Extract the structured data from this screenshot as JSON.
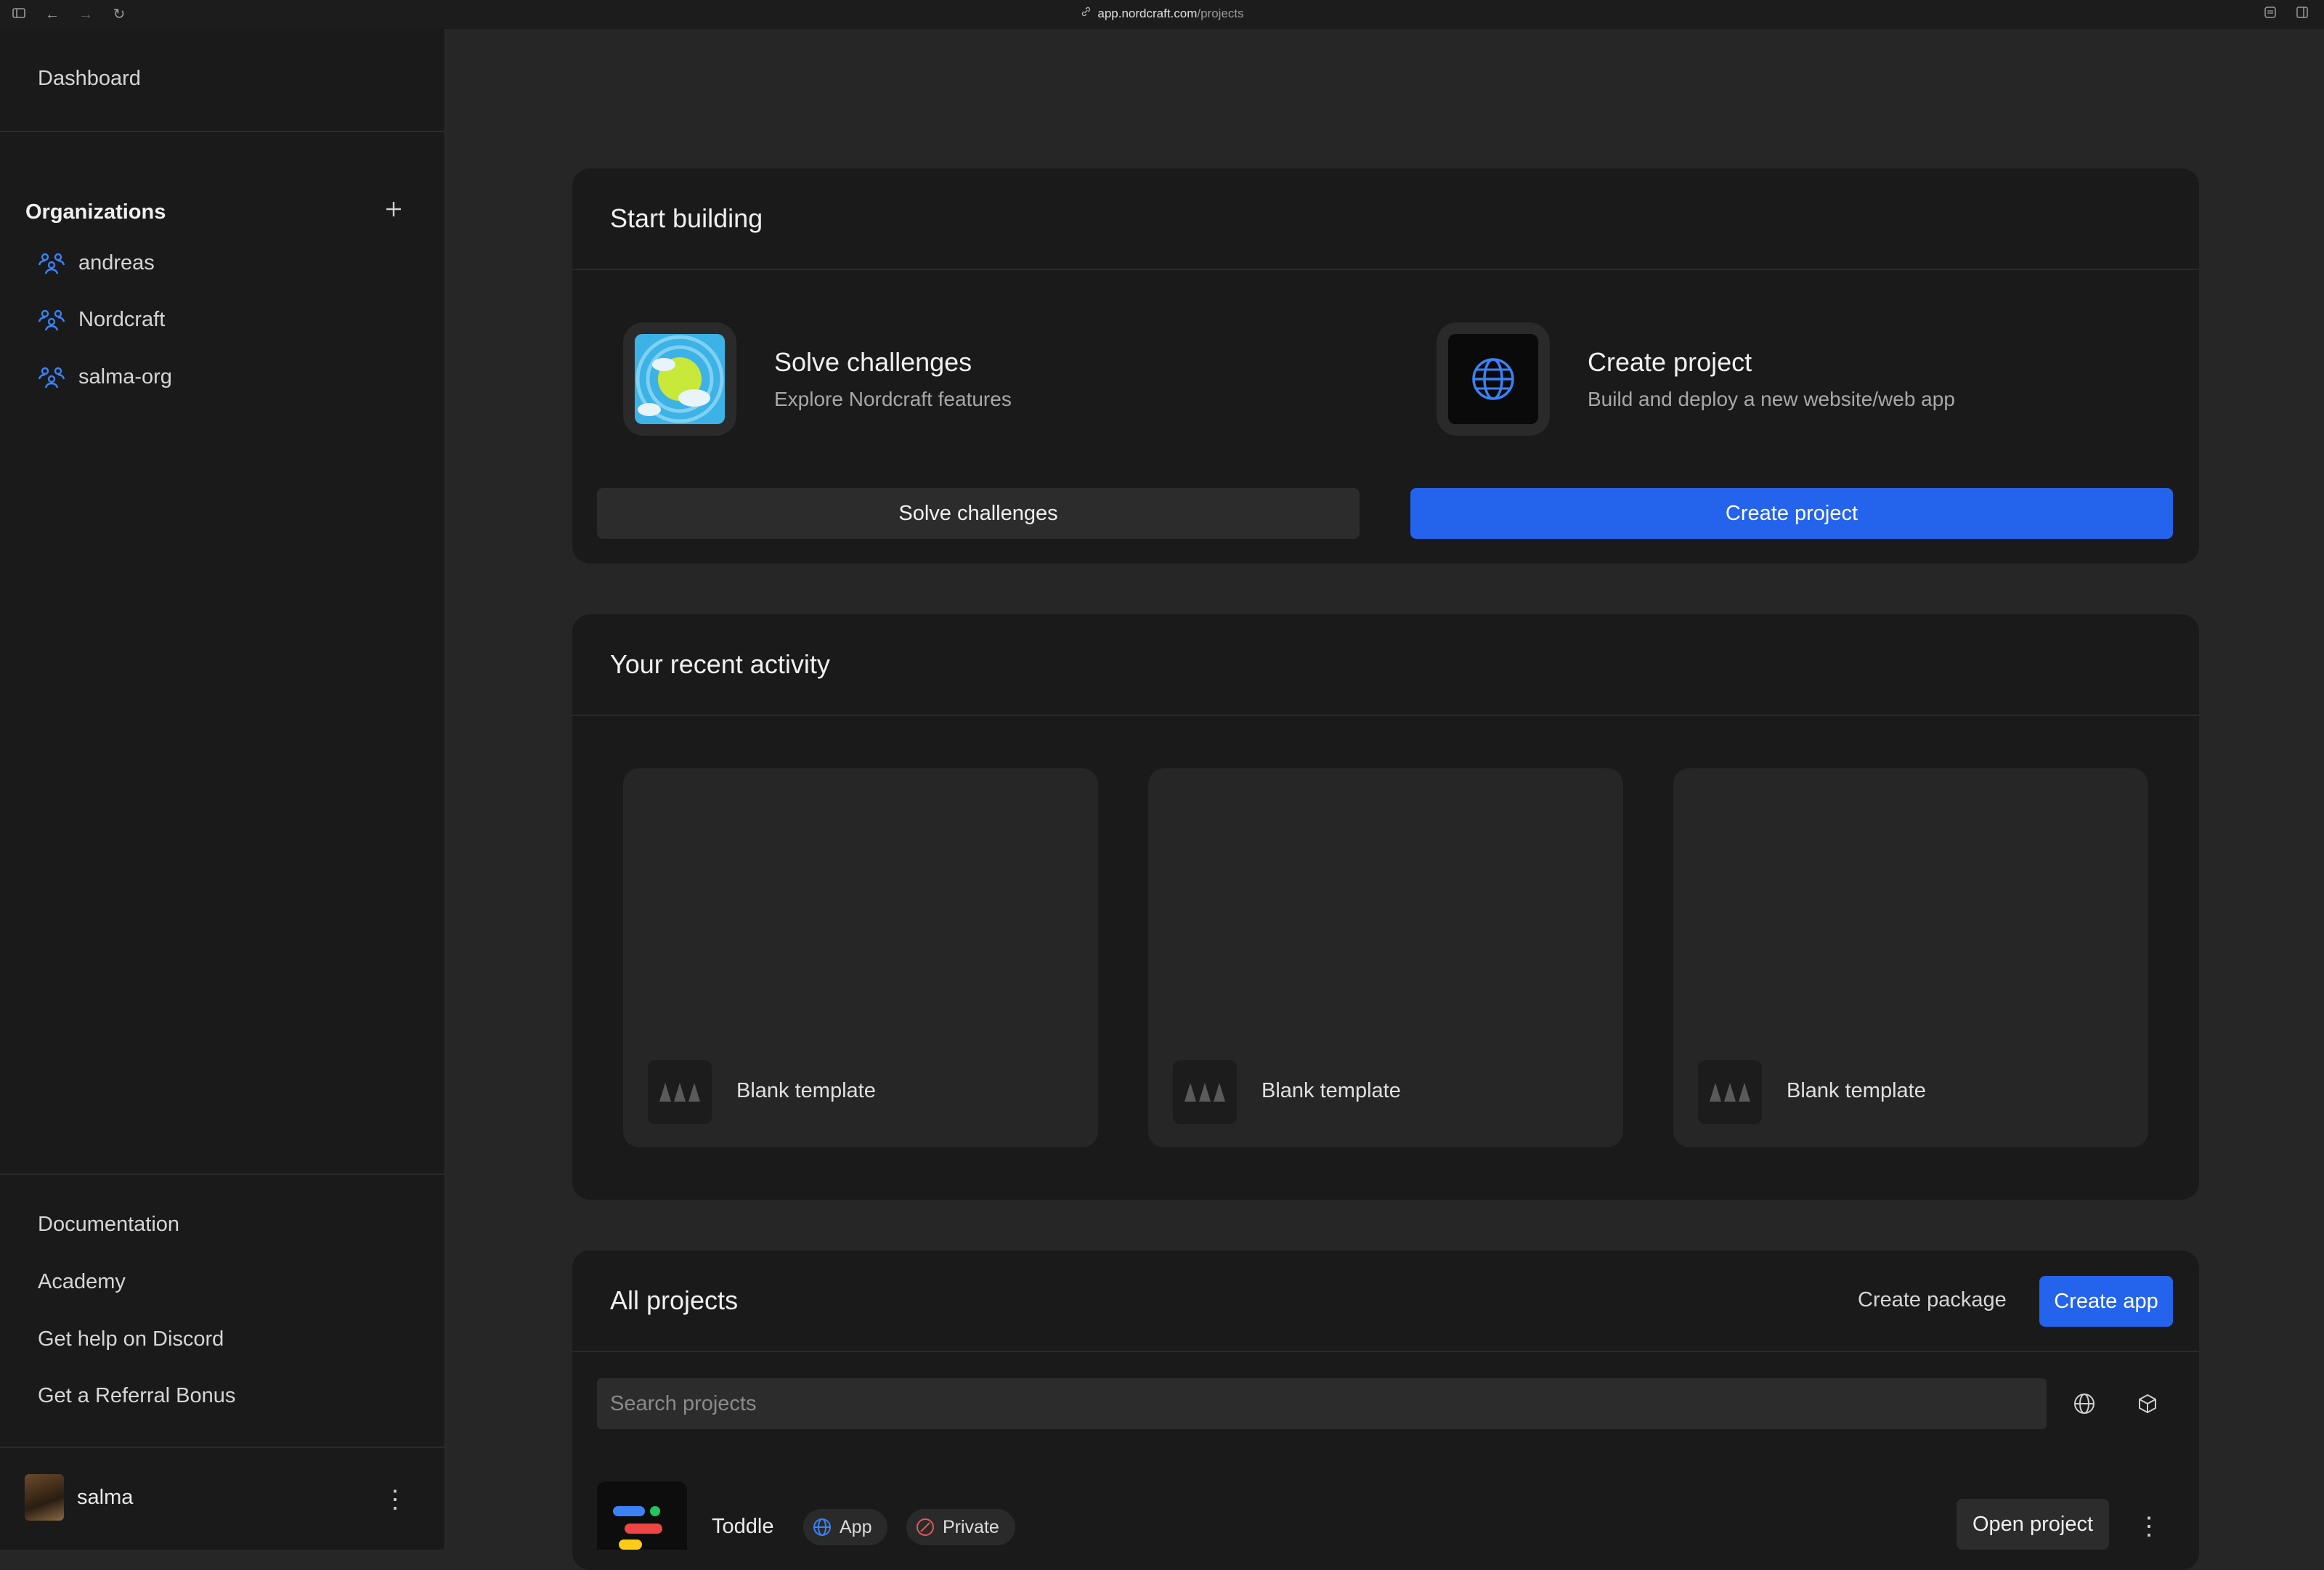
{
  "browser": {
    "url_host": "app.nordcraft.com",
    "url_path": "/projects"
  },
  "sidebar": {
    "dashboard": "Dashboard",
    "organizations_title": "Organizations",
    "organizations": [
      {
        "label": "andreas"
      },
      {
        "label": "Nordcraft"
      },
      {
        "label": "salma-org"
      }
    ],
    "footer_links": [
      {
        "label": "Documentation"
      },
      {
        "label": "Academy"
      },
      {
        "label": "Get help on Discord"
      },
      {
        "label": "Get a Referral Bonus"
      }
    ],
    "user": {
      "name": "salma"
    }
  },
  "start_building": {
    "title": "Start building",
    "challenges": {
      "title": "Solve challenges",
      "subtitle": "Explore Nordcraft features",
      "button": "Solve challenges"
    },
    "create": {
      "title": "Create project",
      "subtitle": "Build and deploy a new website/web app",
      "button": "Create project"
    }
  },
  "recent_activity": {
    "title": "Your recent activity",
    "items": [
      {
        "label": "Blank template"
      },
      {
        "label": "Blank template"
      },
      {
        "label": "Blank template"
      }
    ]
  },
  "all_projects": {
    "title": "All projects",
    "create_package": "Create package",
    "create_app": "Create app",
    "search_placeholder": "Search projects",
    "projects": [
      {
        "name": "Toddle",
        "type_badge": "App",
        "visibility_badge": "Private",
        "open_button": "Open project"
      }
    ]
  },
  "colors": {
    "accent": "#2463eb",
    "background": "#262626",
    "panel": "#1a1a1a",
    "org_icon": "#3b82f6",
    "private_icon": "#e05a5a"
  }
}
